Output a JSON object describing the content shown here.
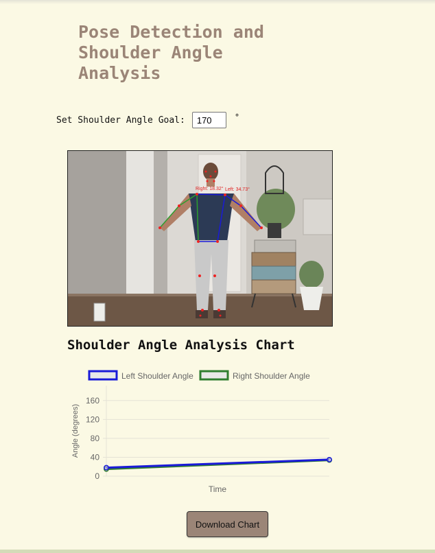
{
  "page": {
    "title": "Pose Detection and Shoulder Angle Analysis"
  },
  "goal": {
    "label": "Set Shoulder Angle Goal:",
    "value": "170",
    "unit": "°"
  },
  "video": {
    "overlay_right": "Right: 18.32°",
    "overlay_left": "Left: 34.73°",
    "colors": {
      "left_arm": "#1a1ad8",
      "right_arm": "#2e9e2e",
      "keypoint": "#ee2222",
      "label": "#e02020"
    }
  },
  "chart_section": {
    "heading": "Shoulder Angle Analysis Chart"
  },
  "chart_data": {
    "type": "line",
    "title": "",
    "xlabel": "Time",
    "ylabel": "Angle (degrees)",
    "ylim": [
      0,
      180
    ],
    "yticks": [
      0,
      40,
      80,
      120,
      160
    ],
    "grid": true,
    "legend_position": "top",
    "series": [
      {
        "name": "Left Shoulder Angle",
        "color": "#1a1ad8",
        "x": [
          0,
          1
        ],
        "values": [
          18,
          35
        ]
      },
      {
        "name": "Right Shoulder Angle",
        "color": "#2f7d2f",
        "x": [
          0,
          1
        ],
        "values": [
          15,
          34
        ]
      }
    ]
  },
  "download": {
    "label": "Download Chart"
  }
}
